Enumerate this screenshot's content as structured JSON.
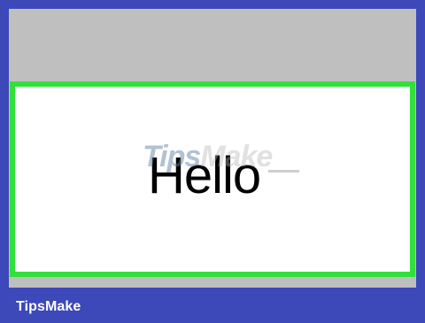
{
  "canvas": {
    "hello_text": "Hello",
    "watermark_text_left": "Tips",
    "watermark_text_right": "Make",
    "colors": {
      "frame": "#3d48b9",
      "screen_top": "#bfbfbf",
      "selection_border": "#33e03b",
      "content_background": "#ffffff",
      "text": "#000000"
    }
  },
  "footer": {
    "brand": "TipsMake"
  }
}
